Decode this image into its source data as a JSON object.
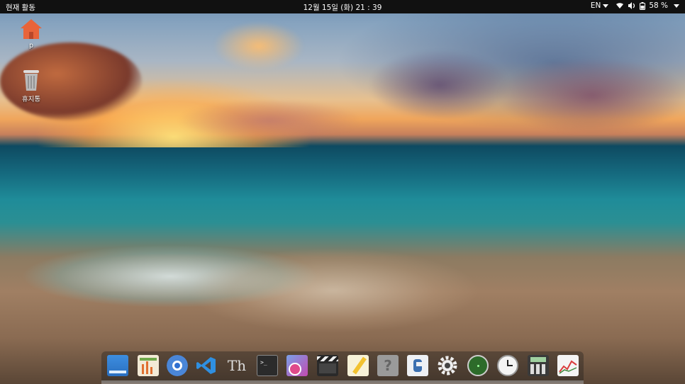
{
  "topbar": {
    "activities": "현재 활동",
    "clock": "12월 15일 (화)  21 : 39",
    "language": "EN",
    "battery": "58 %"
  },
  "desktop": {
    "home_label": "p",
    "trash_label": "휴지통"
  },
  "dock": {
    "apps": [
      "files-icon",
      "spreadsheet-icon",
      "chromium-icon",
      "vscode-icon",
      "fonts-icon",
      "terminal-icon",
      "screenshot-icon",
      "video-editor-icon",
      "text-editor-icon",
      "help-icon",
      "software-icon",
      "settings-icon",
      "radar-icon",
      "clock-icon",
      "calculator-icon",
      "system-monitor-icon"
    ]
  },
  "colors": {
    "topbar": "#111111",
    "home_folder": "#e8643a",
    "vscode": "#2f8fe0"
  }
}
